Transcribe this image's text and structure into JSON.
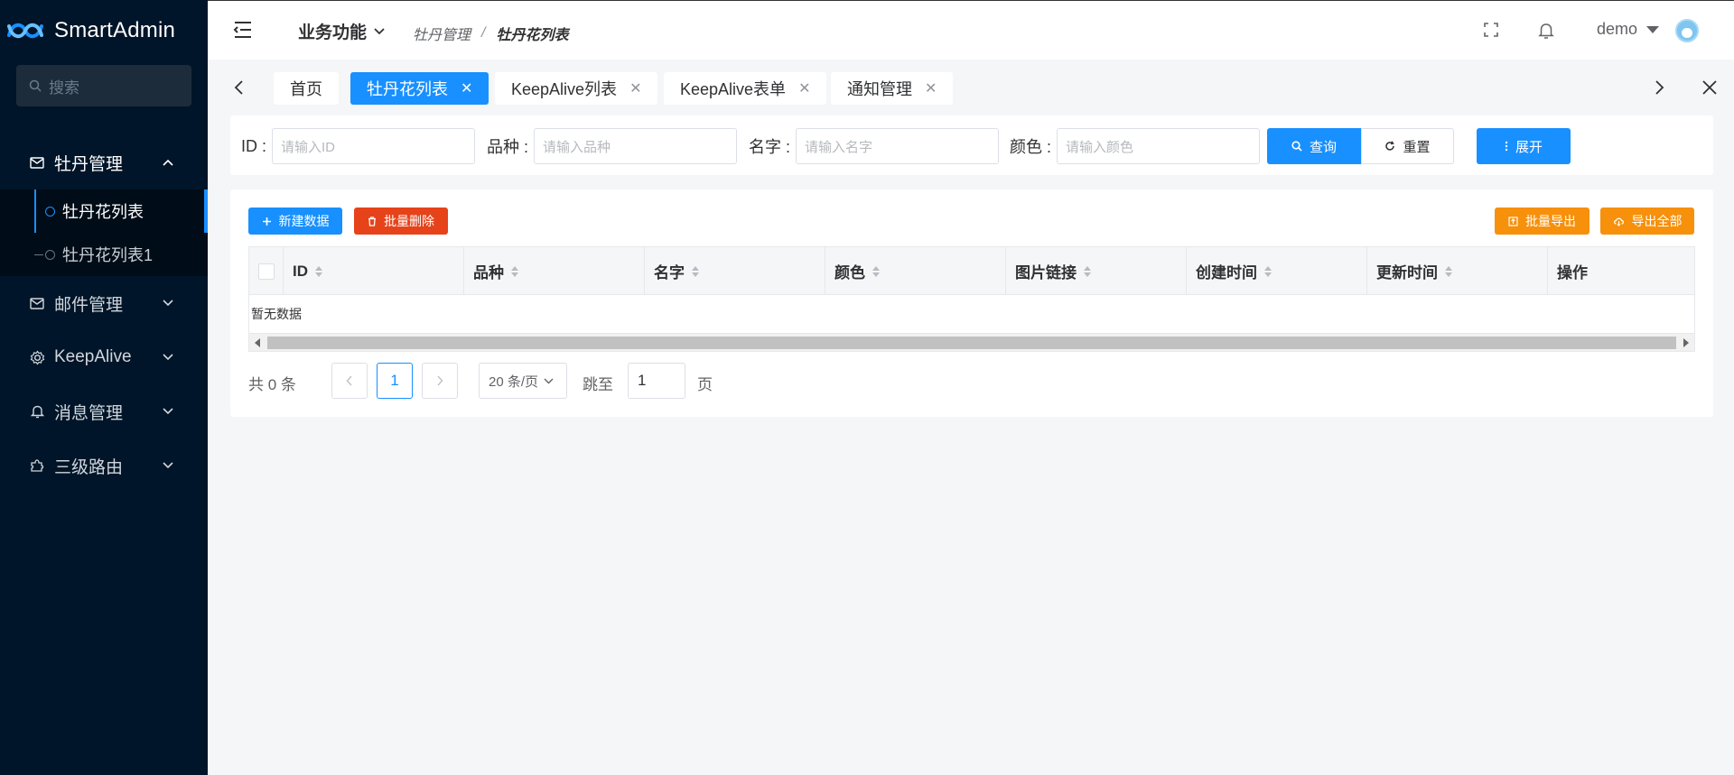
{
  "app": {
    "name": "SmartAdmin",
    "brand_color": "#1890ff"
  },
  "sidebar": {
    "search_placeholder": "搜索",
    "menu": [
      {
        "label": "牡丹管理",
        "icon": "mail-icon",
        "open": true,
        "children": [
          {
            "label": "牡丹花列表",
            "active": true
          },
          {
            "label": "牡丹花列表1",
            "active": false
          }
        ]
      },
      {
        "label": "邮件管理",
        "icon": "mail-icon"
      },
      {
        "label": "KeepAlive",
        "icon": "gear-icon"
      },
      {
        "label": "消息管理",
        "icon": "bell-icon"
      },
      {
        "label": "三级路由",
        "icon": "puzzle-icon"
      }
    ]
  },
  "topbar": {
    "menu_title": "业务功能",
    "breadcrumb": [
      "牡丹管理",
      "/",
      "牡丹花列表"
    ],
    "user": "demo"
  },
  "tabs": [
    {
      "label": "首页",
      "closable": false
    },
    {
      "label": "牡丹花列表",
      "closable": true,
      "active": true
    },
    {
      "label": "KeepAlive列表",
      "closable": true
    },
    {
      "label": "KeepAlive表单",
      "closable": true
    },
    {
      "label": "通知管理",
      "closable": true
    }
  ],
  "search_form": {
    "fields": [
      {
        "label": "ID :",
        "placeholder": "请输入ID"
      },
      {
        "label": "品种 :",
        "placeholder": "请输入品种"
      },
      {
        "label": "名字 :",
        "placeholder": "请输入名字"
      },
      {
        "label": "颜色 :",
        "placeholder": "请输入颜色"
      }
    ],
    "query_label": "查询",
    "reset_label": "重置",
    "expand_label": "展开"
  },
  "toolbar": {
    "add_label": "新建数据",
    "batch_delete_label": "批量删除",
    "batch_export_label": "批量导出",
    "export_all_label": "导出全部",
    "danger_color": "#e6431a",
    "warning_color": "#f7900a"
  },
  "table": {
    "columns": [
      "ID",
      "品种",
      "名字",
      "颜色",
      "图片链接",
      "创建时间",
      "更新时间",
      "操作"
    ],
    "empty_text": "暂无数据"
  },
  "pagination": {
    "total_text": "共 0 条",
    "current_page": "1",
    "page_size": "20 条/页",
    "jump_label": "跳至",
    "jump_value": "1",
    "page_suffix": "页"
  }
}
